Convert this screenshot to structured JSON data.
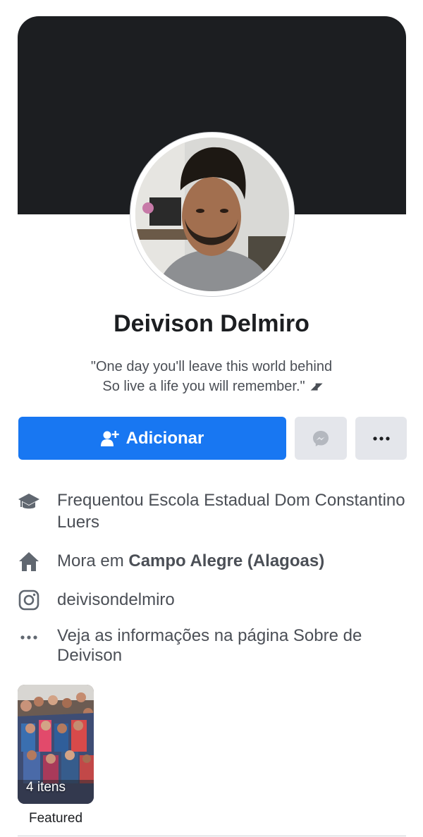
{
  "profile": {
    "name": "Deivison Delmiro",
    "bio_line1": "\"One day you'll leave this world behind",
    "bio_line2": "So live a life you will remember.\"",
    "bio_expand_icon": "expand-arrows-icon"
  },
  "actions": {
    "add_label": "Adicionar",
    "add_icon": "add-friend-icon",
    "message_icon": "messenger-icon",
    "more_icon": "more-options-icon",
    "primary_color": "#1877f2"
  },
  "intro": {
    "education": "Frequentou Escola Estadual Dom Constantino Luers",
    "lives_prefix": "Mora em ",
    "lives_place": "Campo Alegre (Alagoas)",
    "instagram": "deivisondelmiro",
    "see_more": "Veja as informações na página Sobre de Deivison"
  },
  "featured": {
    "count_label": "4 itens",
    "label": "Featured"
  }
}
